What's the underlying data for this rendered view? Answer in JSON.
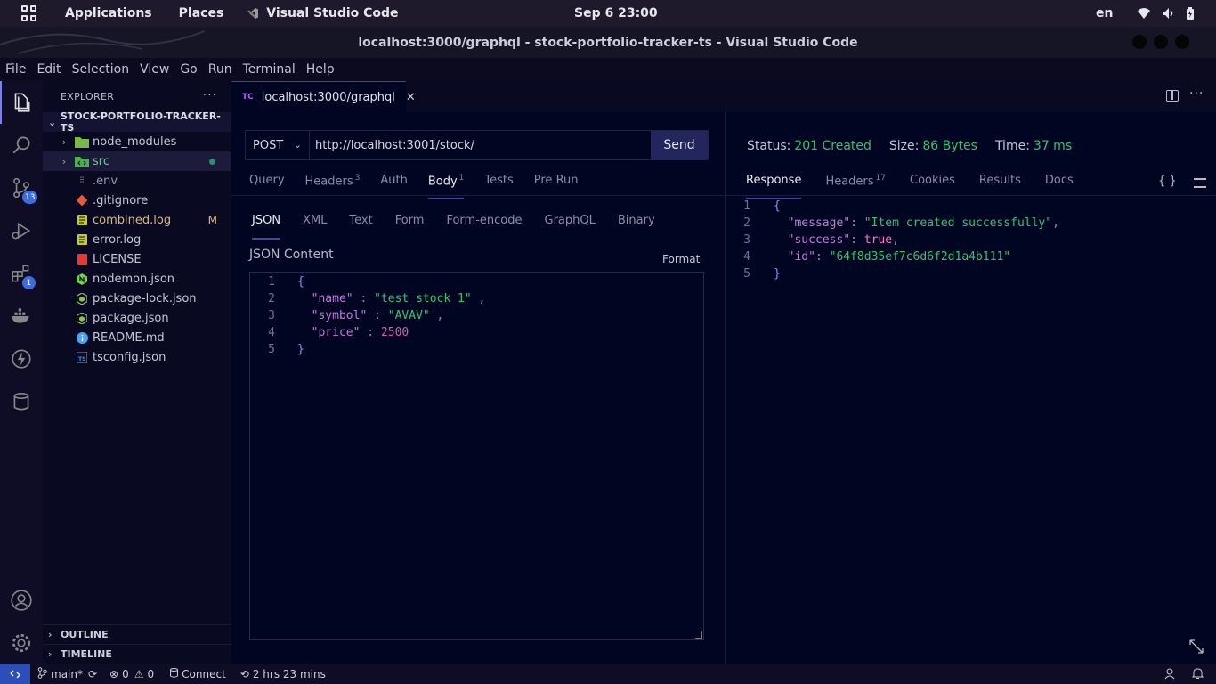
{
  "topbar": {
    "applications": "Applications",
    "places": "Places",
    "app_name": "Visual Studio Code",
    "clock": "Sep 6  23:00",
    "lang": "en"
  },
  "window": {
    "title": "localhost:3000/graphql - stock-portfolio-tracker-ts - Visual Studio Code"
  },
  "menu": [
    "File",
    "Edit",
    "Selection",
    "View",
    "Go",
    "Run",
    "Terminal",
    "Help"
  ],
  "activity": {
    "scm_badge": "13",
    "extensions_badge": "1"
  },
  "sidebar": {
    "title": "EXPLORER",
    "project": "STOCK-PORTFOLIO-TRACKER-TS",
    "items": [
      {
        "name": "node_modules",
        "type": "folder"
      },
      {
        "name": "src",
        "type": "folder"
      },
      {
        "name": ".env",
        "type": "file"
      },
      {
        "name": ".gitignore",
        "type": "file"
      },
      {
        "name": "combined.log",
        "type": "file",
        "badge": "M"
      },
      {
        "name": "error.log",
        "type": "file"
      },
      {
        "name": "LICENSE",
        "type": "file"
      },
      {
        "name": "nodemon.json",
        "type": "file"
      },
      {
        "name": "package-lock.json",
        "type": "file"
      },
      {
        "name": "package.json",
        "type": "file"
      },
      {
        "name": "README.md",
        "type": "file"
      },
      {
        "name": "tsconfig.json",
        "type": "file"
      }
    ],
    "outline": "OUTLINE",
    "timeline": "TIMELINE"
  },
  "tab": {
    "prefix": "TC",
    "label": "localhost:3000/graphql"
  },
  "request": {
    "method": "POST",
    "url": "http://localhost:3001/stock/",
    "send_label": "Send",
    "tabs": [
      {
        "label": "Query",
        "sup": ""
      },
      {
        "label": "Headers",
        "sup": "3"
      },
      {
        "label": "Auth",
        "sup": ""
      },
      {
        "label": "Body",
        "sup": "1"
      },
      {
        "label": "Tests",
        "sup": ""
      },
      {
        "label": "Pre Run",
        "sup": ""
      }
    ],
    "body_tabs": [
      "JSON",
      "XML",
      "Text",
      "Form",
      "Form-encode",
      "GraphQL",
      "Binary"
    ],
    "json_title": "JSON Content",
    "format_label": "Format",
    "lines": [
      "1",
      "2",
      "3",
      "4",
      "5"
    ],
    "body": {
      "open": "{",
      "k1": "\"name\"",
      "v1": "\"test stock 1\"",
      "k2": "\"symbol\"",
      "v2": "\"AVAV\"",
      "k3": "\"price\"",
      "v3": "2500",
      "close": "}"
    }
  },
  "response": {
    "status_label": "Status:",
    "status_value": "201 Created",
    "size_label": "Size:",
    "size_value": "86 Bytes",
    "time_label": "Time:",
    "time_value": "37 ms",
    "tabs": [
      {
        "label": "Response",
        "sup": ""
      },
      {
        "label": "Headers",
        "sup": "17"
      },
      {
        "label": "Cookies",
        "sup": ""
      },
      {
        "label": "Results",
        "sup": ""
      },
      {
        "label": "Docs",
        "sup": ""
      }
    ],
    "braces_label": "{ }",
    "lines": [
      "1",
      "2",
      "3",
      "4",
      "5"
    ],
    "body": {
      "open": "{",
      "k1": "\"message\"",
      "v1": "\"Item created successfully\"",
      "k2": "\"success\"",
      "v2": "true",
      "k3": "\"id\"",
      "v3": "\"64f8d35ef7c6d6f2d1a4b111\"",
      "close": "}"
    }
  },
  "statusbar": {
    "branch": "main*",
    "errors": "0",
    "warnings": "0",
    "connect": "Connect",
    "time": "2 hrs 23 mins"
  },
  "colors": {
    "accent": "#3d6be0",
    "success": "#38c172",
    "modified": "#d7ba7d"
  }
}
